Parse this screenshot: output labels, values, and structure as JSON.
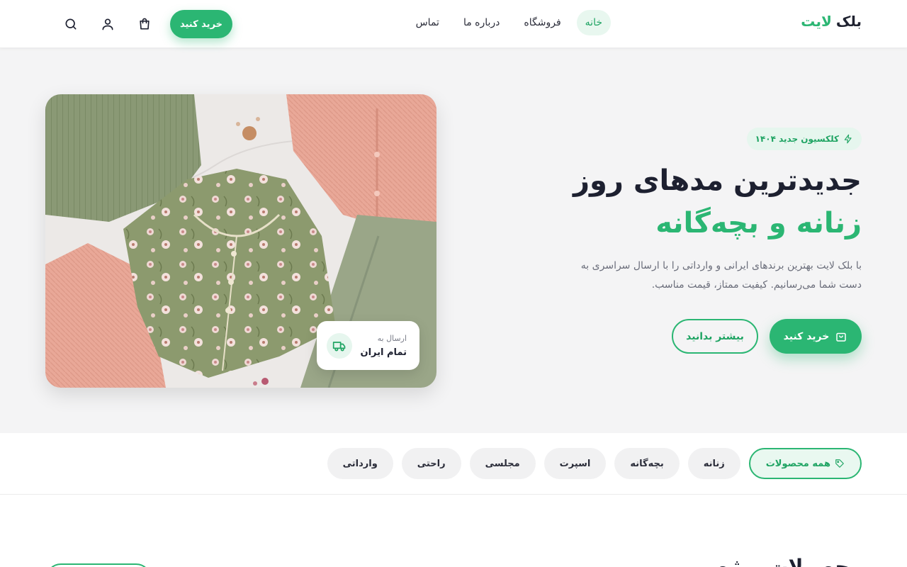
{
  "header": {
    "logo_part1": "بلک",
    "logo_part2": "لایت",
    "nav": [
      {
        "label": "خانه"
      },
      {
        "label": "فروشگاه"
      },
      {
        "label": "درباره ما"
      },
      {
        "label": "تماس"
      }
    ],
    "buy_button": "خرید کنید",
    "icons": [
      "search-icon",
      "user-icon",
      "cart-icon"
    ]
  },
  "hero": {
    "badge": "کلکسیون جدید ۱۴۰۴",
    "title_line1": "جدیدترین مدهای روز",
    "title_line2": "زنانه و بچه‌گانه",
    "description": "با بلک لایت بهترین برندهای ایرانی و وارداتی را با ارسال سراسری به دست شما می‌رسانیم. کیفیت ممتاز، قیمت مناسب.",
    "primary_button": "خرید کنید",
    "secondary_button": "بیشتر بدانید",
    "shipping_small": "ارسال به",
    "shipping_big": "تمام ایران"
  },
  "categories": [
    {
      "label": "همه محصولات"
    },
    {
      "label": "زنانه"
    },
    {
      "label": "بچه‌گانه"
    },
    {
      "label": "اسپرت"
    },
    {
      "label": "مجلسی"
    },
    {
      "label": "راحتی"
    },
    {
      "label": "وارداتی"
    }
  ],
  "next_section": {
    "title": "محصولات ویژه"
  },
  "colors": {
    "accent": "#2bb673",
    "accent_soft": "#e6f6ee",
    "hero_bg": "#f4f4f5",
    "text_dark": "#1d2030"
  }
}
